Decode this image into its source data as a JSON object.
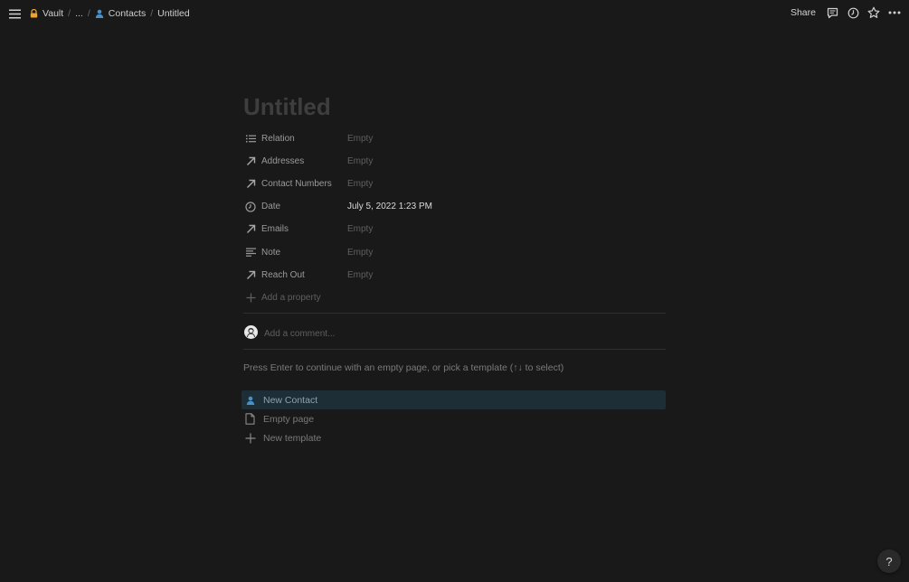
{
  "topbar": {
    "breadcrumbs": [
      {
        "label": "Vault",
        "icon": "lock-icon"
      },
      {
        "label": "..."
      },
      {
        "label": "Contacts",
        "icon": "person-icon"
      },
      {
        "label": "Untitled"
      }
    ],
    "share_label": "Share"
  },
  "page": {
    "title": "Untitled",
    "properties": [
      {
        "name": "Relation",
        "icon": "list-icon",
        "value": "Empty"
      },
      {
        "name": "Addresses",
        "icon": "arrow-up-right-icon",
        "value": "Empty"
      },
      {
        "name": "Contact Numbers",
        "icon": "arrow-up-right-icon",
        "value": "Empty"
      },
      {
        "name": "Date",
        "icon": "clock-icon",
        "value": "July 5, 2022 1:23 PM"
      },
      {
        "name": "Emails",
        "icon": "arrow-up-right-icon",
        "value": "Empty"
      },
      {
        "name": "Note",
        "icon": "text-lines-icon",
        "value": "Empty"
      },
      {
        "name": "Reach Out",
        "icon": "arrow-up-right-icon",
        "value": "Empty"
      }
    ],
    "add_property_label": "Add a property",
    "comment_placeholder": "Add a comment...",
    "hint": "Press Enter to continue with an empty page, or pick a template (↑↓ to select)",
    "templates": [
      {
        "label": "New Contact",
        "icon": "person-icon",
        "selected": true
      },
      {
        "label": "Empty page",
        "icon": "document-icon"
      },
      {
        "label": "New template",
        "icon": "plus-icon"
      }
    ]
  },
  "help_label": "?",
  "colors": {
    "background": "#191919",
    "lock": "#e8a33b",
    "person": "#4a90c8",
    "selected_template": "#1d2e36"
  }
}
